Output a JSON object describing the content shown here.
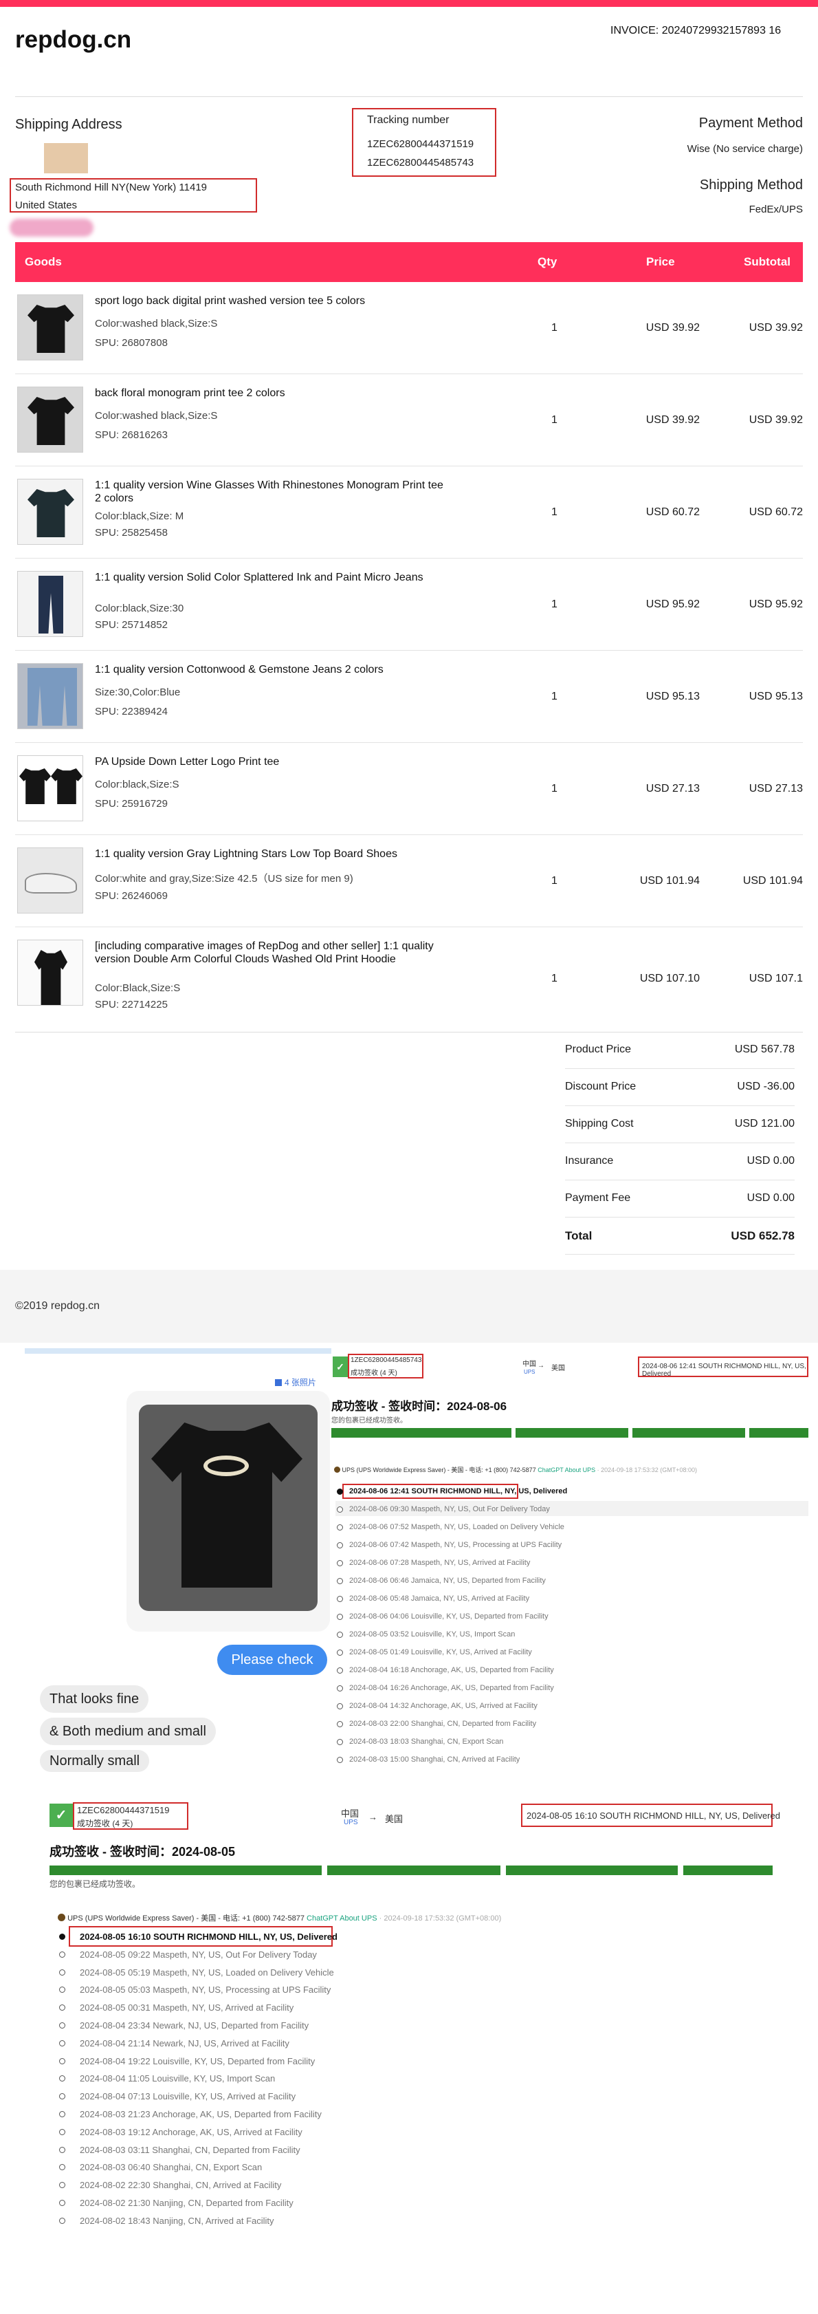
{
  "brand": {
    "logo": "repdog.cn",
    "accent_color": "#ff2f5a"
  },
  "invoice": {
    "label": "INVOICE:",
    "number": "20240729932157893 16"
  },
  "shipping_address": {
    "title": "Shipping Address",
    "line1": "South Richmond Hill NY(New York) 11419",
    "line2": "United States"
  },
  "tracking": {
    "title": "Tracking number",
    "numbers": [
      "1ZEC62800444371519",
      "1ZEC62800445485743"
    ]
  },
  "payment": {
    "title": "Payment Method",
    "value": "Wise (No service charge)"
  },
  "shipping_method": {
    "title": "Shipping Method",
    "value": "FedEx/UPS"
  },
  "goods_header": {
    "goods": "Goods",
    "qty": "Qty",
    "price": "Price",
    "subtotal": "Subtotal"
  },
  "items": [
    {
      "title": "sport logo back digital print washed version tee 5 colors",
      "attr": "Color:washed black,Size:S",
      "spu": "SPU: 26807808",
      "qty": "1",
      "price": "USD 39.92",
      "subtotal": "USD 39.92",
      "thumb": "tee-icon"
    },
    {
      "title": "back floral monogram print tee 2 colors",
      "attr": "Color:washed black,Size:S",
      "spu": "SPU: 26816263",
      "qty": "1",
      "price": "USD 39.92",
      "subtotal": "USD 39.92",
      "thumb": "tee-icon"
    },
    {
      "title": "1:1 quality version Wine Glasses With Rhinestones Monogram Print tee 2 colors",
      "attr": "Color:black,Size: M",
      "spu": "SPU: 25825458",
      "qty": "1",
      "price": "USD 60.72",
      "subtotal": "USD 60.72",
      "thumb": "tee-icon"
    },
    {
      "title": "1:1 quality version Solid Color Splattered Ink and Paint Micro Jeans",
      "attr": "Color:black,Size:30",
      "spu": "SPU: 25714852",
      "qty": "1",
      "price": "USD 95.92",
      "subtotal": "USD 95.92",
      "thumb": "jeans-icon"
    },
    {
      "title": "1:1 quality version Cottonwood & Gemstone Jeans 2 colors",
      "attr": "Size:30,Color:Blue",
      "spu": "SPU: 22389424",
      "qty": "1",
      "price": "USD 95.13",
      "subtotal": "USD 95.13",
      "thumb": "jeans-icon"
    },
    {
      "title": "PA Upside Down Letter Logo Print tee",
      "attr": "Color:black,Size:S",
      "spu": "SPU: 25916729",
      "qty": "1",
      "price": "USD 27.13",
      "subtotal": "USD 27.13",
      "thumb": "tee-icon"
    },
    {
      "title": "1:1 quality version Gray Lightning Stars Low Top Board Shoes",
      "attr": "Color:white and gray,Size:Size 42.5（US size for men 9)",
      "spu": "SPU: 26246069",
      "qty": "1",
      "price": "USD 101.94",
      "subtotal": "USD 101.94",
      "thumb": "shoe-icon"
    },
    {
      "title": "[including comparative images of RepDog and other seller] 1:1 quality version Double Arm Colorful Clouds Washed Old Print Hoodie",
      "attr": "Color:Black,Size:S",
      "spu": "SPU: 22714225",
      "qty": "1",
      "price": "USD 107.10",
      "subtotal": "USD 107.1",
      "thumb": "hoodie-icon"
    }
  ],
  "summary": [
    {
      "label": "Product Price",
      "value": "USD 567.78"
    },
    {
      "label": "Discount Price",
      "value": "USD -36.00"
    },
    {
      "label": "Shipping Cost",
      "value": "USD 121.00"
    },
    {
      "label": "Insurance",
      "value": "USD 0.00"
    },
    {
      "label": "Payment Fee",
      "value": "USD 0.00"
    },
    {
      "label": "Total",
      "value": "USD 652.78"
    }
  ],
  "footer": {
    "copyright": "©2019 repdog.cn"
  },
  "chat": {
    "photo_count": "4 张照片",
    "outgoing": "Please check",
    "incoming": [
      "That looks fine",
      "& Both medium and small",
      "Normally small"
    ]
  },
  "tracking1": {
    "number": "1ZEC62800445485743",
    "status_days": "成功签收 (4 天)",
    "origin": "中国",
    "origin_carrier": "UPS",
    "dest": "美国",
    "latest": "2024-08-06 12:41 SOUTH RICHMOND HILL, NY, US, Delivered",
    "headline": "成功签收 - 签收时间：2024-08-06",
    "subline": "您的包裹已经成功签收。",
    "carrier_line": "UPS (UPS Worldwide Express Saver) - 美国 - 电话: +1 (800) 742-5877",
    "chatgpt": "ChatGPT About UPS",
    "query_time": "· 2024-09-18 17:53:32 (GMT+08:00)",
    "events": [
      "2024-08-06 12:41 SOUTH RICHMOND HILL, NY, US, Delivered",
      "2024-08-06 09:30 Maspeth, NY, US, Out For Delivery Today",
      "2024-08-06 07:52 Maspeth, NY, US, Loaded on Delivery Vehicle",
      "2024-08-06 07:42 Maspeth, NY, US, Processing at UPS Facility",
      "2024-08-06 07:28 Maspeth, NY, US, Arrived at Facility",
      "2024-08-06 06:46 Jamaica, NY, US, Departed from Facility",
      "2024-08-06 05:48 Jamaica, NY, US, Arrived at Facility",
      "2024-08-06 04:06 Louisville, KY, US, Departed from Facility",
      "2024-08-05 03:52 Louisville, KY, US, Import Scan",
      "2024-08-05 01:49 Louisville, KY, US, Arrived at Facility",
      "2024-08-04 16:18 Anchorage, AK, US, Departed from Facility",
      "2024-08-04 16:26 Anchorage, AK, US, Departed from Facility",
      "2024-08-04 14:32 Anchorage, AK, US, Arrived at Facility",
      "2024-08-03 22:00 Shanghai, CN, Departed from Facility",
      "2024-08-03 18:03 Shanghai, CN, Export Scan",
      "2024-08-03 15:00 Shanghai, CN, Arrived at Facility"
    ]
  },
  "tracking2": {
    "number": "1ZEC62800444371519",
    "status_days": "成功签收 (4 天)",
    "origin": "中国",
    "origin_carrier": "UPS",
    "dest": "美国",
    "latest": "2024-08-05 16:10 SOUTH RICHMOND HILL, NY, US, Delivered",
    "headline": "成功签收 - 签收时间：2024-08-05",
    "subline": "您的包裹已经成功签收。",
    "carrier_line": "UPS (UPS Worldwide Express Saver) - 美国 - 电话: +1 (800) 742-5877",
    "chatgpt": "ChatGPT About UPS",
    "query_time": "· 2024-09-18 17:53:32 (GMT+08:00)",
    "events": [
      "2024-08-05 16:10 SOUTH RICHMOND HILL, NY, US, Delivered",
      "2024-08-05 09:22 Maspeth, NY, US, Out For Delivery Today",
      "2024-08-05 05:19 Maspeth, NY, US, Loaded on Delivery Vehicle",
      "2024-08-05 05:03 Maspeth, NY, US, Processing at UPS Facility",
      "2024-08-05 00:31 Maspeth, NY, US, Arrived at Facility",
      "2024-08-04 23:34 Newark, NJ, US, Departed from Facility",
      "2024-08-04 21:14 Newark, NJ, US, Arrived at Facility",
      "2024-08-04 19:22 Louisville, KY, US, Departed from Facility",
      "2024-08-04 11:05 Louisville, KY, US, Import Scan",
      "2024-08-04 07:13 Louisville, KY, US, Arrived at Facility",
      "2024-08-03 21:23 Anchorage, AK, US, Departed from Facility",
      "2024-08-03 19:12 Anchorage, AK, US, Arrived at Facility",
      "2024-08-03 03:11 Shanghai, CN, Departed from Facility",
      "2024-08-03 06:40 Shanghai, CN, Export Scan",
      "2024-08-02 22:30 Shanghai, CN, Arrived at Facility",
      "2024-08-02 21:30 Nanjing, CN, Departed from Facility",
      "2024-08-02 18:43 Nanjing, CN, Arrived at Facility"
    ]
  }
}
